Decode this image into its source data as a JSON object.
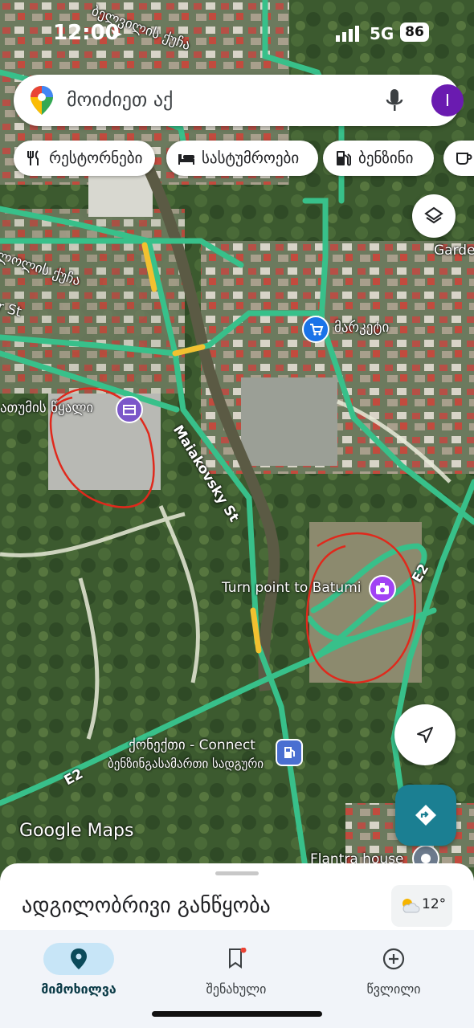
{
  "status_bar": {
    "time": "12:00",
    "network": "5G",
    "battery": "86"
  },
  "search": {
    "placeholder": "მოიძიეთ აქ",
    "avatar_letter": "I"
  },
  "chips": [
    {
      "icon": "fork-knife-icon",
      "label": "რესტორნები"
    },
    {
      "icon": "bed-icon",
      "label": "სასტუმროები"
    },
    {
      "icon": "gas-pump-icon",
      "label": "ბენზინი"
    },
    {
      "icon": "coffee-cup-icon",
      "label": ""
    }
  ],
  "map": {
    "labels": {
      "street_top": "ბელვილის ქუჩა",
      "street_left": "ლოლის ქუჩა",
      "street_st": "r St",
      "malakovsky": "Maiakovsky St",
      "market": "მარკეტი",
      "water": "ათუმის წყალი",
      "turn_point": "Turn point to Batumi",
      "route_a": "E2",
      "route_b": "E2",
      "connect_name": "ქონექთი - Connect",
      "connect_type": "ბენზინგასამართი სადგური",
      "flantra": "Flantra house",
      "garden": "Garde",
      "watermark": "Google Maps"
    },
    "colors": {
      "road": "#38c08a",
      "traffic": "#f2c130",
      "annotation": "#e0291c",
      "market_poi": "#1a73e8",
      "photo_poi": "#a142f4",
      "fuel_poi": "#4a6fd1",
      "directions": "#1b7f92"
    }
  },
  "sheet": {
    "title": "ადგილობრივი განწყობა",
    "temperature": "12°"
  },
  "nav": [
    {
      "icon": "location-pin-icon",
      "label": "მიმოხილვა",
      "active": true
    },
    {
      "icon": "bookmark-icon",
      "label": "შენახული",
      "active": false
    },
    {
      "icon": "add-circle-icon",
      "label": "წვლილი",
      "active": false
    }
  ]
}
